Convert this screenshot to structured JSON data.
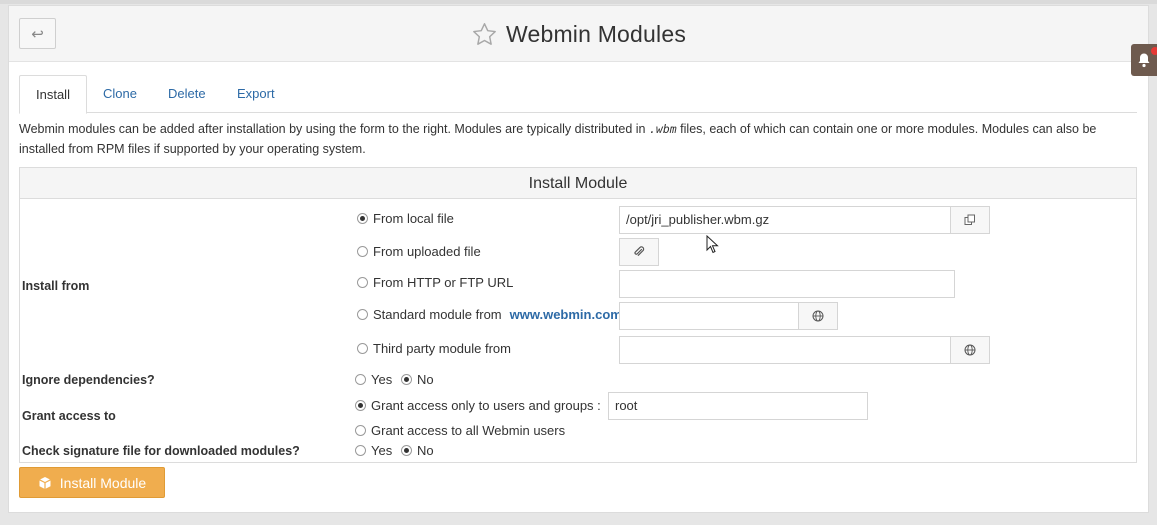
{
  "page_title": "Webmin Modules",
  "tabs": [
    {
      "label": "Install",
      "active": true
    },
    {
      "label": "Clone",
      "active": false
    },
    {
      "label": "Delete",
      "active": false
    },
    {
      "label": "Export",
      "active": false
    }
  ],
  "description": {
    "before": "Webmin modules can be added after installation by using the form to the right. Modules are typically distributed in",
    "ext": ".wbm",
    "after": "files, each of which can contain one or more modules. Modules can also be installed from RPM files if supported by your operating system."
  },
  "form": {
    "heading": "Install Module",
    "install_from": {
      "label": "Install from",
      "options": {
        "local": "From local file",
        "uploaded": "From uploaded file",
        "url": "From HTTP or FTP URL",
        "standard": "Standard module from",
        "standard_link": "www.webmin.com",
        "third": "Third party module from"
      },
      "selected": "local",
      "local_path": "/opt/jri_publisher.wbm.gz",
      "url_value": "",
      "standard_value": "",
      "third_value": ""
    },
    "ignore_dependencies": {
      "label": "Ignore dependencies?",
      "yes": "Yes",
      "no": "No",
      "selected": "no"
    },
    "grant_access": {
      "label": "Grant access to",
      "only_label": "Grant access only to users and groups :",
      "only_value": "root",
      "all_label": "Grant access to all Webmin users",
      "selected": "only"
    },
    "check_signature": {
      "label": "Check signature file for downloaded modules?",
      "yes": "Yes",
      "no": "No",
      "selected": "no"
    },
    "submit_label": "Install Module"
  },
  "colors": {
    "accent_button": "#f0ad4e",
    "link": "#2d6aa6",
    "notification_tab": "#6e5a4e"
  },
  "icons": {
    "back": "back-arrow-icon",
    "title": "star-icon",
    "file_chooser": "file-chooser-icon",
    "upload": "paperclip-icon",
    "browse": "globe-icon",
    "submit": "package-icon",
    "notification": "bell-icon"
  }
}
